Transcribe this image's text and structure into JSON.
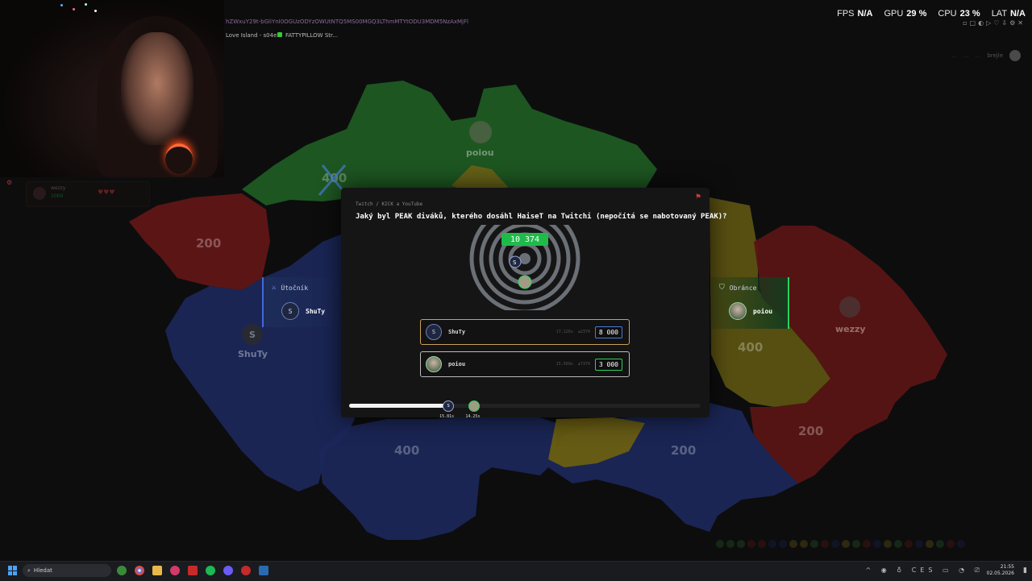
{
  "overlay": {
    "url_text": "hZWxuY29t-bGliYnI0OGUzODYzOWUtNTQ5MS00MGQ3LThmMTYtODU3MDM5NzAxMjFl",
    "tab1": "Love Island - s04e...",
    "tab2": "FATTYPILLOW Str...",
    "stats": [
      {
        "label": "FPS",
        "value": "N/A"
      },
      {
        "label": "GPU",
        "value": "29 %"
      },
      {
        "label": "CPU",
        "value": "23 %"
      },
      {
        "label": "LAT",
        "value": "N/A"
      }
    ]
  },
  "header": {
    "nav": [
      "...",
      "...",
      "..."
    ],
    "user": "brejle"
  },
  "map": {
    "regions": [
      {
        "label": "400",
        "color": "#2e7d2e"
      },
      {
        "label": "200",
        "color": "#7a1c1c"
      },
      {
        "label": "400",
        "color": "#8a7d1a"
      },
      {
        "label": "200",
        "color": "#7a1c1c"
      },
      {
        "label": "400",
        "color": "#1f2d6a"
      },
      {
        "label": "200",
        "color": "#1f2d6a"
      }
    ],
    "labels": {
      "green_top": "400",
      "west_red": "200",
      "east_yellow": "400",
      "east_red": "200",
      "south_blue": "400",
      "southeast_blue": "200"
    },
    "player_tags": {
      "north": "poiou",
      "west": "ShuTy",
      "west_initial": "S",
      "east": "wezzy"
    }
  },
  "left_panel": {
    "player": "wezzy",
    "score": "1000"
  },
  "attacker": {
    "role": "Útočník",
    "initial": "S",
    "name": "ShuTy"
  },
  "defender": {
    "role": "Obránce",
    "name": "poiou"
  },
  "question": {
    "category": "Twitch / KICK a YouTube",
    "text": "Jaký byl PEAK diváků, kterého dosáhl HaiseT na Twitchi (nepočítá se nabotovaný PEAK)?",
    "correct_answer": "10 374",
    "answers": [
      {
        "initial": "S",
        "name": "ShuTy",
        "time": "17.126s",
        "diff": "±2374",
        "answer": "8 000",
        "border": "#4a7bd8"
      },
      {
        "name": "poiou",
        "time": "15.569s",
        "diff": "±7374",
        "answer": "3 000",
        "border": "#2fd15a"
      }
    ],
    "timer": {
      "progress": 0.28,
      "marks": [
        {
          "initial": "S",
          "label": "15.81s",
          "position": 0.28
        },
        {
          "label": "14.25s",
          "position": 0.354
        }
      ]
    }
  },
  "taskbar": {
    "search_placeholder": "Hledat",
    "lang": "CES",
    "time": "21:55",
    "date": "02.05.2026"
  }
}
